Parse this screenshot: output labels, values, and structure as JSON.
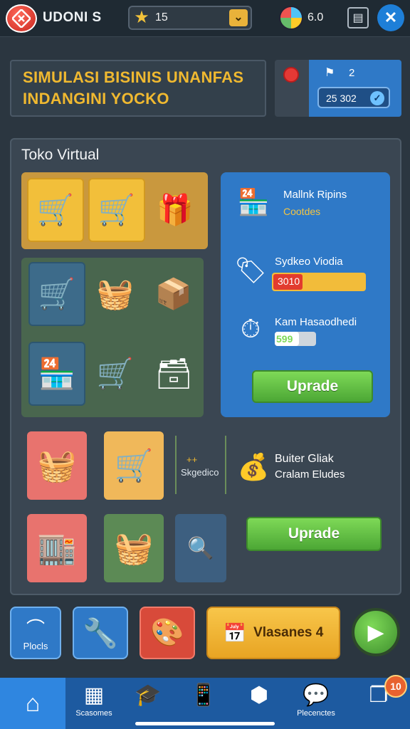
{
  "topbar": {
    "app_title": "UDONI S",
    "level": "15",
    "coins": "6.0",
    "icons": [
      "logo-icon",
      "star-icon",
      "chevron-down-icon",
      "globe-coin-icon",
      "document-icon",
      "close-icon"
    ]
  },
  "banner": {
    "line1": "SIMULASI BISINIS UNANFAS",
    "line2": "INDANGINI YOCKO"
  },
  "stats": {
    "count": "2",
    "value": "25 302"
  },
  "store": {
    "title": "Toko Virtual",
    "side": {
      "item1_title": "Mallnk Ripins",
      "item1_sub": "Cootdes",
      "item2_title": "Sydkeo Viodia",
      "item2_value": "3010",
      "item2_progress": 0.32,
      "item3_title": "Kam Hasaodhedi",
      "item3_value": "599",
      "upgrade_label": "Uprade"
    },
    "bottom": {
      "side_label_top": "++",
      "side_label": "Skgedico",
      "info_line1": "Buiter Gliak",
      "info_line2": "Cralam Eludes",
      "upgrade_label": "Uprade"
    }
  },
  "actions": {
    "profile_label": "Plocls",
    "mission_label": "Vlasanes 4"
  },
  "nav": {
    "item2_label": "Scasomes",
    "item6_label": "Plecenctes",
    "badge": "10"
  },
  "colors": {
    "accent_blue": "#2f79c7",
    "accent_yellow": "#f0b930",
    "accent_green": "#4ca735",
    "background": "#2b3640"
  }
}
